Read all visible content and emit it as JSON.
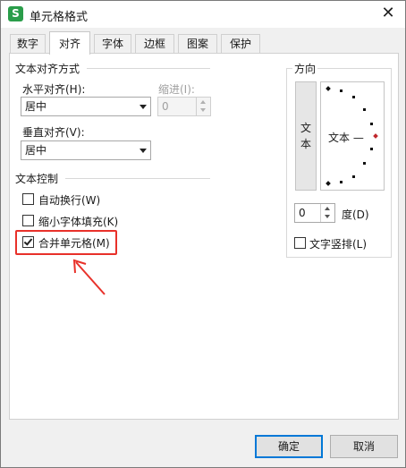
{
  "window": {
    "title": "单元格格式",
    "app_icon": "wps-spreadsheet-icon"
  },
  "tabs": [
    {
      "label": "数字",
      "active": false
    },
    {
      "label": "对齐",
      "active": true
    },
    {
      "label": "字体",
      "active": false
    },
    {
      "label": "边框",
      "active": false
    },
    {
      "label": "图案",
      "active": false
    },
    {
      "label": "保护",
      "active": false
    }
  ],
  "text_alignment": {
    "group_label": "文本对齐方式",
    "horizontal_label": "水平对齐(H):",
    "horizontal_value": "居中",
    "indent_label": "缩进(I):",
    "indent_value": "0",
    "vertical_label": "垂直对齐(V):",
    "vertical_value": "居中"
  },
  "text_control": {
    "group_label": "文本控制",
    "wrap_text": {
      "label": "自动换行(W)",
      "checked": false
    },
    "shrink_to_fit": {
      "label": "缩小字体填充(K)",
      "checked": false
    },
    "merge_cells": {
      "label": "合并单元格(M)",
      "checked": true
    }
  },
  "orientation": {
    "group_label": "方向",
    "vertical_text_char1": "文",
    "vertical_text_char2": "本",
    "dial_text": "文本 —",
    "degree_value": "0",
    "degree_label": "度(D)",
    "stacked_text": {
      "label": "文字竖排(L)",
      "checked": false
    }
  },
  "buttons": {
    "ok": "确定",
    "cancel": "取消"
  },
  "colors": {
    "highlight": "#e8312a",
    "dial_marker": "#c0282d",
    "default_button_border": "#0078d7"
  }
}
